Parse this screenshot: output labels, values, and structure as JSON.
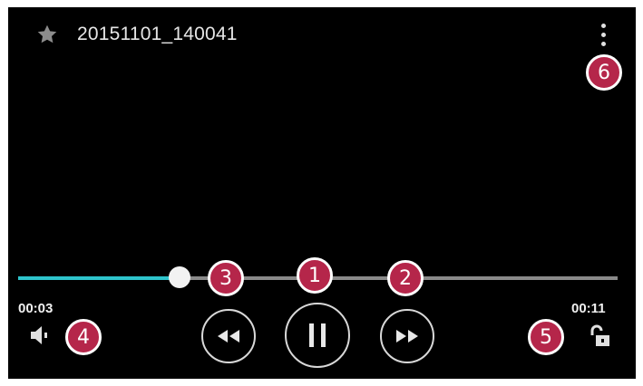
{
  "header": {
    "title": "20151101_140041"
  },
  "icons": {
    "star": "star-icon",
    "more": "more-vert-icon",
    "volume": "volume-icon",
    "rewind": "rewind-icon",
    "pause": "pause-icon",
    "fast_forward": "fast-forward-icon",
    "lock": "unlock-icon"
  },
  "playback": {
    "current_time": "00:03",
    "duration": "00:11",
    "progress": 0.27
  },
  "callouts": [
    "1",
    "2",
    "3",
    "4",
    "5",
    "6"
  ],
  "colors": {
    "background": "#000000",
    "progress_played": "#2ec4cc",
    "progress_track": "#8a8a8a",
    "callout": "#b5264a"
  }
}
